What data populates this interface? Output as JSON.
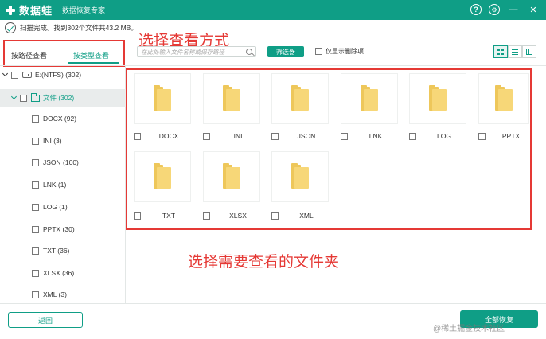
{
  "app": {
    "name": "数据蛙",
    "subtitle": "数据恢复专家"
  },
  "window_controls": {
    "help": "?",
    "settings": "⚙",
    "minimize": "—",
    "close": "✕"
  },
  "scan": {
    "status_text": "扫描完成。找到302个文件共43.2 MB。"
  },
  "annotations": {
    "top_label": "选择查看方式",
    "bottom_label": "选择需要查看的文件夹",
    "color": "#e53935"
  },
  "tabs": {
    "by_path": "按路径查看",
    "by_type": "按类型查看",
    "active": "by_type"
  },
  "search": {
    "placeholder": "在此处输入文件名称或保存路径"
  },
  "toolbar": {
    "filter_label": "筛选器",
    "only_deleted_label": "仅显示删除项"
  },
  "tree": {
    "drive": "E:(NTFS) (302)",
    "root_folder": "文件 (302)",
    "types": [
      "DOCX (92)",
      "INI (3)",
      "JSON (100)",
      "LNK (1)",
      "LOG (1)",
      "PPTX (30)",
      "TXT (36)",
      "XLSX (36)",
      "XML (3)"
    ]
  },
  "folders": [
    "DOCX",
    "INI",
    "JSON",
    "LNK",
    "LOG",
    "PPTX",
    "TXT",
    "XLSX",
    "XML"
  ],
  "footer": {
    "back_label": "返回",
    "recover_label": "全部恢复",
    "watermark": "@稀土掘金技术社区"
  },
  "colors": {
    "accent": "#0f9e86",
    "folder": "#f7d778"
  }
}
